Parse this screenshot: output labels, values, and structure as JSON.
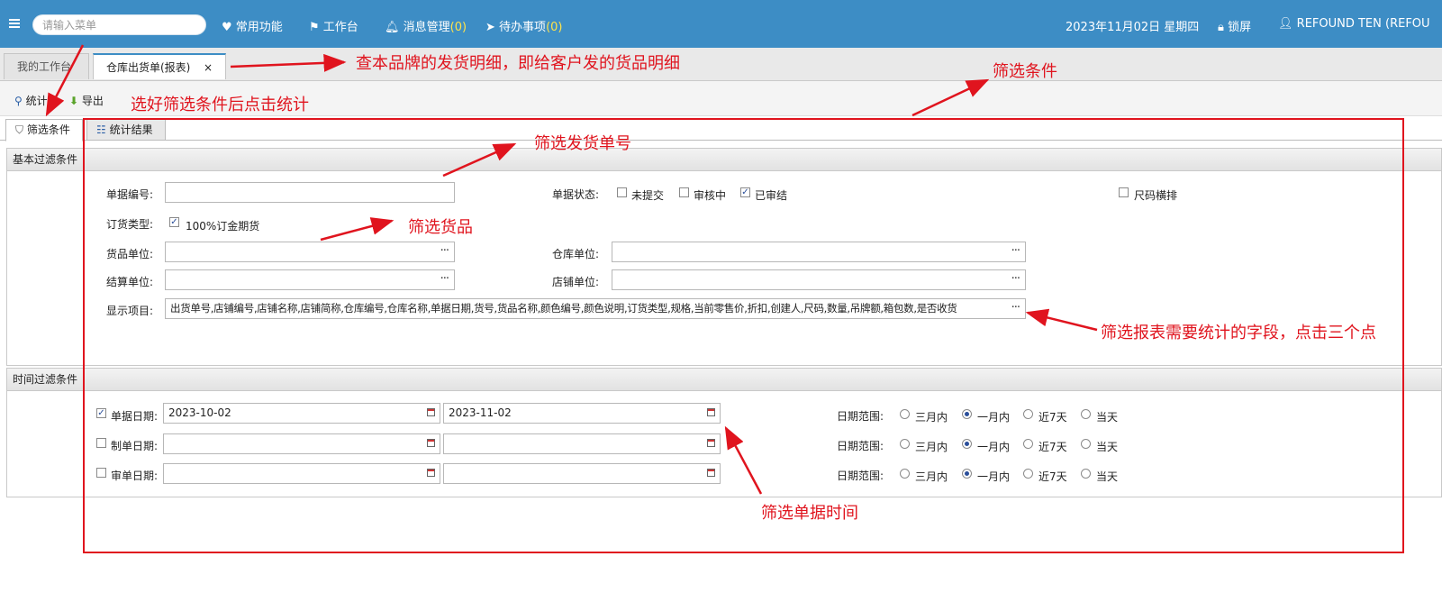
{
  "topbar": {
    "menu_icon": "hamburger-icon",
    "search_placeholder": "请输入菜单",
    "common": "常用功能",
    "workbench": "工作台",
    "messages": "消息管理",
    "messages_count": "(0)",
    "todos": "待办事项",
    "todos_count": "(0)",
    "date": "2023年11月02日 星期四",
    "lock": "锁屏",
    "user": "REFOUND TEN (REFOU"
  },
  "tabs": {
    "my_workbench": "我的工作台",
    "report": "仓库出货单(报表)",
    "close": "×"
  },
  "toolbar": {
    "stat": "统计",
    "export": "导出"
  },
  "inner_tabs": {
    "filter": "筛选条件",
    "result": "统计结果"
  },
  "basic": {
    "title": "基本过滤条件",
    "doc_no_label": "单据编号:",
    "doc_no_value": "",
    "status_label": "单据状态:",
    "status_options": [
      {
        "label": "未提交",
        "checked": false
      },
      {
        "label": "审核中",
        "checked": false
      },
      {
        "label": "已审结",
        "checked": true
      }
    ],
    "size_label": "尺码横排",
    "size_checked": false,
    "order_type_label": "订货类型:",
    "order_type_option": "100%订金期货",
    "order_type_checked": true,
    "goods_unit_label": "货品单位:",
    "warehouse_unit_label": "仓库单位:",
    "settle_unit_label": "结算单位:",
    "shop_unit_label": "店铺单位:",
    "display_label": "显示项目:",
    "display_value": "出货单号,店铺编号,店铺名称,店铺简称,仓库编号,仓库名称,单据日期,货号,货品名称,颜色编号,颜色说明,订货类型,规格,当前零售价,折扣,创建人,尺码,数量,吊牌额,箱包数,是否收货"
  },
  "time": {
    "title": "时间过滤条件",
    "rows": [
      {
        "label": "单据日期:",
        "checked": true,
        "from": "2023-10-02",
        "to": "2023-11-02"
      },
      {
        "label": "制单日期:",
        "checked": false,
        "from": "",
        "to": ""
      },
      {
        "label": "审单日期:",
        "checked": false,
        "from": "",
        "to": ""
      }
    ],
    "range_label": "日期范围:",
    "range_options": [
      "三月内",
      "一月内",
      "近7天",
      "当天"
    ],
    "range_selected": "一月内"
  },
  "annotations": {
    "a1": "查本品牌的发货明细，即给客户发的货品明细",
    "a2": "选好筛选条件后点击统计",
    "a3": "筛选条件",
    "a4": "筛选发货单号",
    "a5": "筛选货品",
    "a6": "筛选报表需要统计的字段，点击三个点",
    "a7": "筛选单据时间"
  },
  "colors": {
    "topbar": "#3d8dc5",
    "annotation": "#e0141e",
    "count": "#ffe34a"
  }
}
